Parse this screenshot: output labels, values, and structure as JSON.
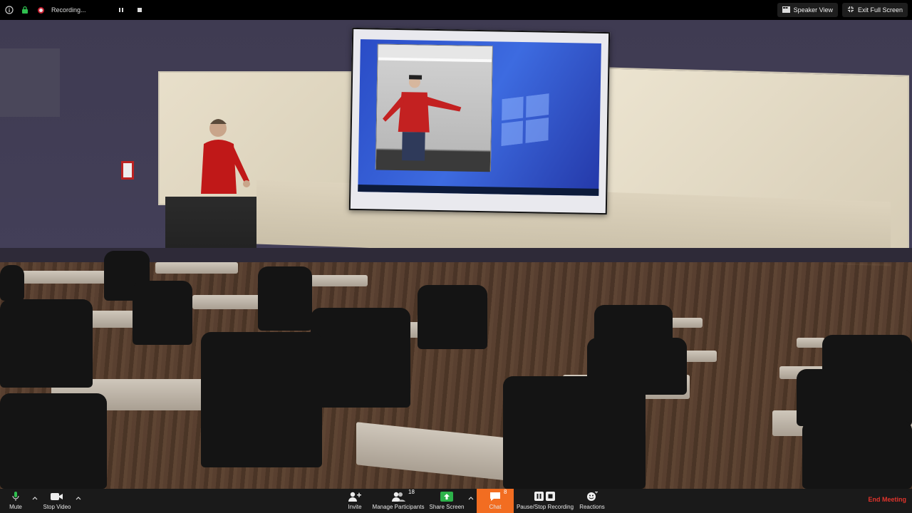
{
  "top_bar": {
    "recording_label": "Recording...",
    "speaker_view_label": "Speaker View",
    "exit_fullscreen_label": "Exit Full Screen"
  },
  "toolbar": {
    "mute_label": "Mute",
    "stop_video_label": "Stop Video",
    "invite_label": "Invite",
    "participants_label": "Manage Participants",
    "participants_count": "18",
    "share_screen_label": "Share Screen",
    "chat_label": "Chat",
    "chat_count": "8",
    "recording_label": "Pause/Stop Recording",
    "reactions_label": "Reactions",
    "end_meeting_label": "End Meeting"
  },
  "colors": {
    "accent_chat": "#f26d21",
    "end_meeting": "#e0342c",
    "share_green": "#2db24a"
  },
  "icons": [
    "info-icon",
    "lock-icon",
    "recording-dot-icon",
    "pause-icon",
    "stop-icon",
    "speaker-view-icon",
    "exit-fullscreen-icon",
    "microphone-icon",
    "video-camera-icon",
    "add-person-icon",
    "participants-icon",
    "share-screen-icon",
    "chat-icon",
    "pause-stop-recording-icon",
    "reactions-icon",
    "caret-up-icon"
  ]
}
